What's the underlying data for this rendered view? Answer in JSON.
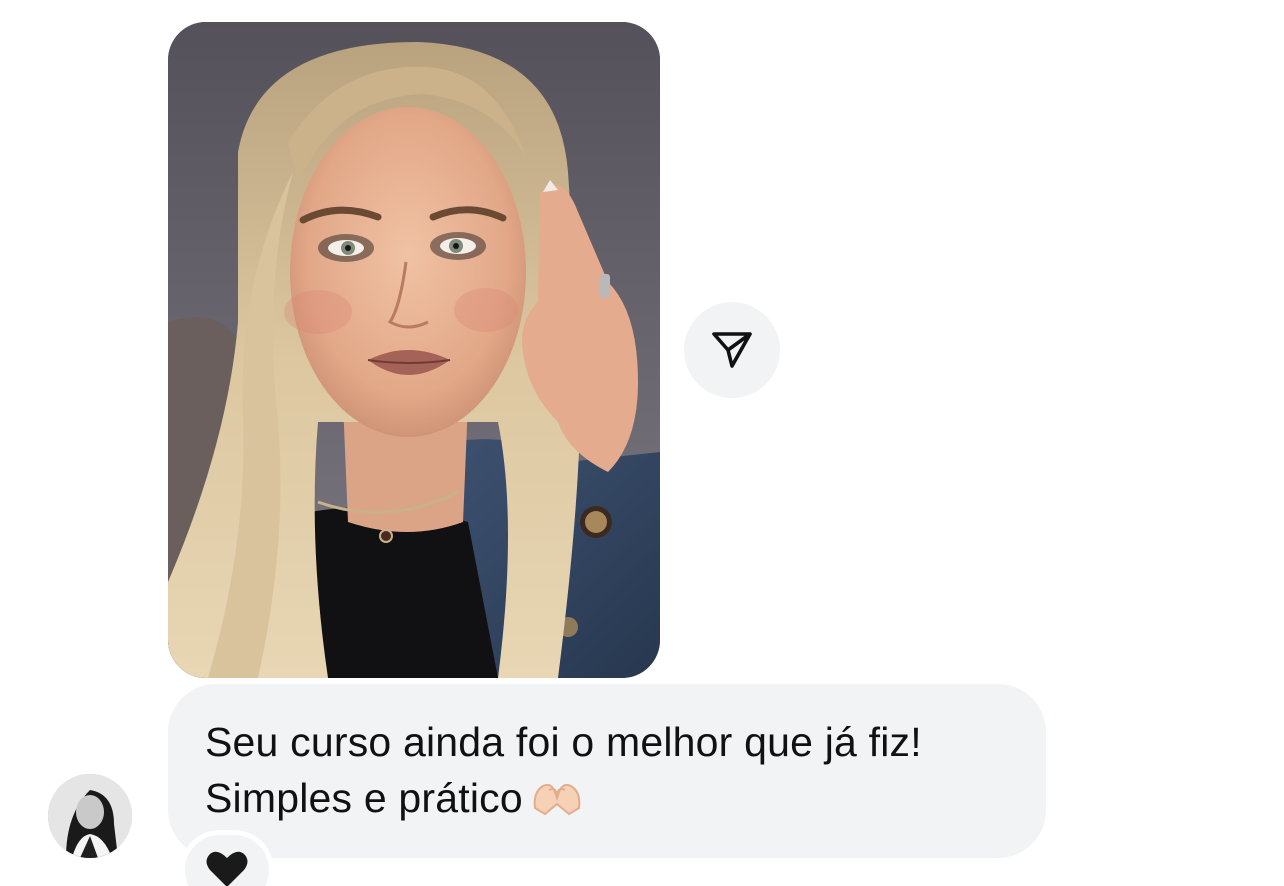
{
  "message": {
    "line1": "Seu curso ainda foi o melhor que já fiz!",
    "line2": "Simples e prático",
    "emoji": "heart-hands-emoji"
  },
  "reaction": {
    "emoji": "black-heart",
    "color": "#1a1a1a"
  },
  "share_button": {
    "icon": "send-icon"
  },
  "colors": {
    "bubble_background": "#f2f3f5",
    "text": "#111111",
    "background": "#ffffff"
  }
}
